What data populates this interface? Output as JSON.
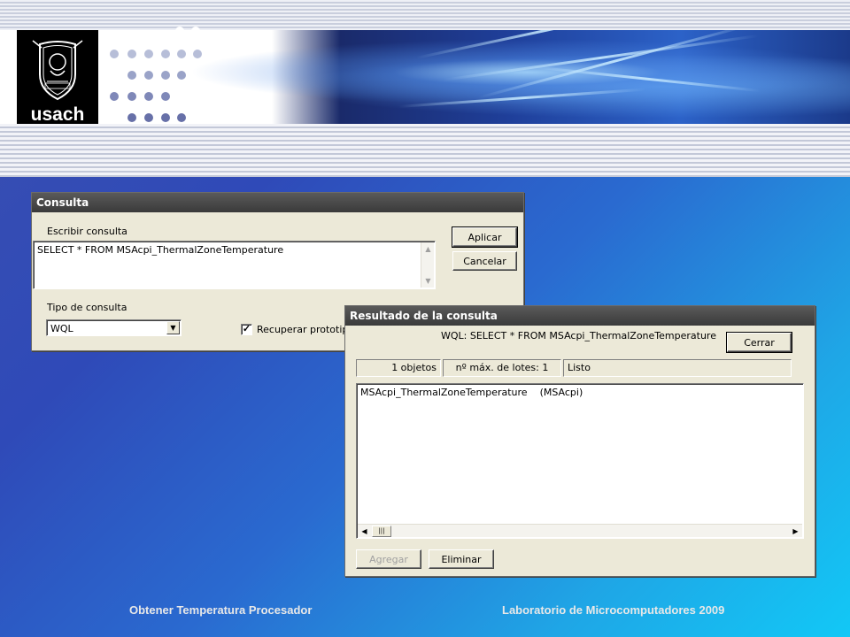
{
  "header": {
    "logo_text": "usach"
  },
  "consulta": {
    "title": "Consulta",
    "query_label": "Escribir consulta",
    "query_value": "SELECT * FROM MSAcpi_ThermalZoneTemperature",
    "apply_label": "Aplicar",
    "cancel_label": "Cancelar",
    "type_label": "Tipo de consulta",
    "type_value": "WQL",
    "prototype_label": "Recuperar prototipo d",
    "prototype_checked": true
  },
  "resultado": {
    "title": "Resultado de la consulta",
    "query_text": "WQL: SELECT * FROM MSAcpi_ThermalZoneTemperature",
    "close_label": "Cerrar",
    "status": {
      "objects": "1 objetos",
      "batches": "nº máx. de lotes: 1",
      "state": "Listo"
    },
    "results": [
      "MSAcpi_ThermalZoneTemperature    (MSAcpi)"
    ],
    "add_label": "Agregar",
    "delete_label": "Eliminar"
  },
  "footer": {
    "left": "Obtener Temperatura Procesador",
    "right": "Laboratorio de Microcomputadores 2009"
  }
}
